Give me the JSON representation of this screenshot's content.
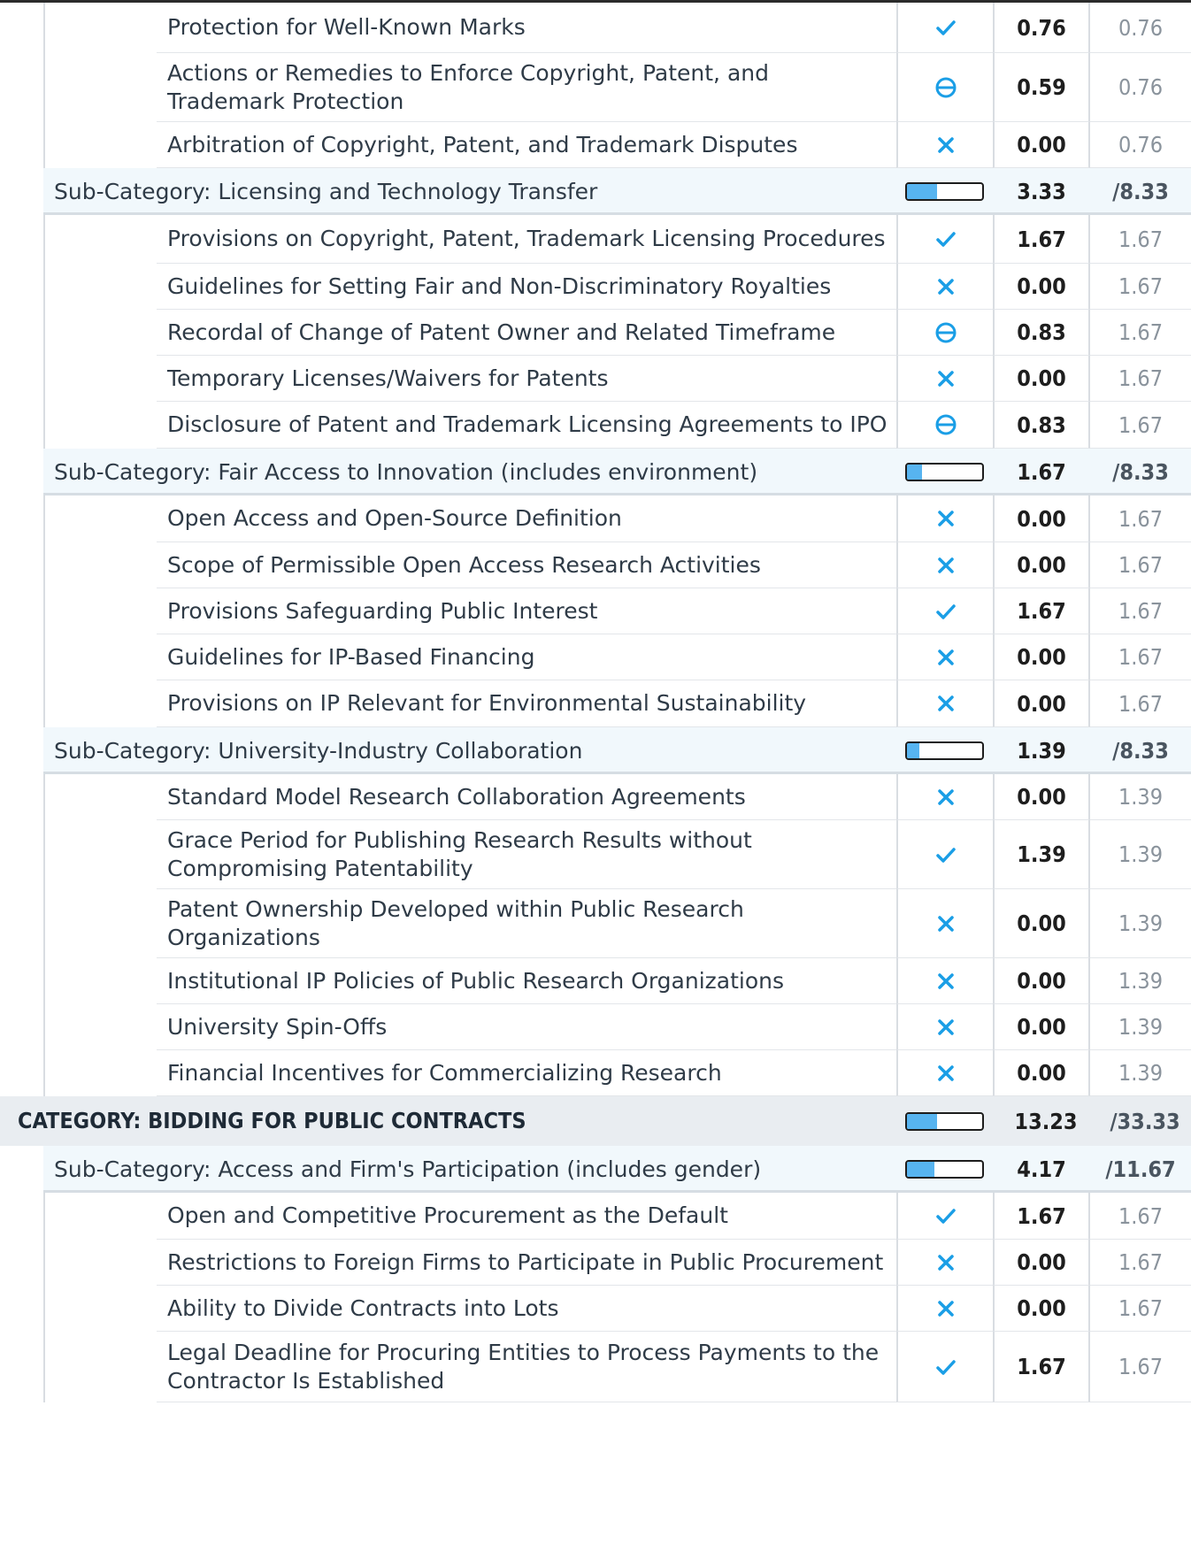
{
  "colors": {
    "accent": "#1a9ee6",
    "bar_fill": "#57b4f0",
    "subcategory_bg": "#f1f8fc",
    "category_bg": "#e9edf1"
  },
  "rows": [
    {
      "kind": "item",
      "label": "Protection for Well-Known Marks",
      "status": "met",
      "score": "0.76",
      "max": "0.76"
    },
    {
      "kind": "item",
      "label": "Actions or Remedies to Enforce Copyright, Patent, and Trademark Protection",
      "status": "partial",
      "score": "0.59",
      "max": "0.76"
    },
    {
      "kind": "item",
      "label": "Arbitration of Copyright, Patent, and Trademark Disputes",
      "status": "not-met",
      "score": "0.00",
      "max": "0.76"
    },
    {
      "kind": "sub",
      "label": "Sub-Category: Licensing and Technology Transfer",
      "progress": 0.4,
      "score": "3.33",
      "max": "/8.33"
    },
    {
      "kind": "item",
      "label": "Provisions on Copyright, Patent, Trademark Licensing Procedures",
      "status": "met",
      "score": "1.67",
      "max": "1.67"
    },
    {
      "kind": "item",
      "label": "Guidelines for Setting Fair and Non-Discriminatory Royalties",
      "status": "not-met",
      "score": "0.00",
      "max": "1.67"
    },
    {
      "kind": "item",
      "label": "Recordal of Change of Patent Owner and Related Timeframe",
      "status": "partial",
      "score": "0.83",
      "max": "1.67"
    },
    {
      "kind": "item",
      "label": "Temporary Licenses/Waivers for Patents",
      "status": "not-met",
      "score": "0.00",
      "max": "1.67"
    },
    {
      "kind": "item",
      "label": "Disclosure of Patent and Trademark Licensing Agreements to IPO",
      "status": "partial",
      "score": "0.83",
      "max": "1.67"
    },
    {
      "kind": "sub",
      "label": "Sub-Category: Fair Access to Innovation (includes environment)",
      "progress": 0.2,
      "score": "1.67",
      "max": "/8.33"
    },
    {
      "kind": "item",
      "label": "Open Access and Open-Source Definition",
      "status": "not-met",
      "score": "0.00",
      "max": "1.67"
    },
    {
      "kind": "item",
      "label": "Scope of Permissible Open Access Research Activities",
      "status": "not-met",
      "score": "0.00",
      "max": "1.67"
    },
    {
      "kind": "item",
      "label": "Provisions Safeguarding Public Interest",
      "status": "met",
      "score": "1.67",
      "max": "1.67"
    },
    {
      "kind": "item",
      "label": "Guidelines for IP-Based Financing",
      "status": "not-met",
      "score": "0.00",
      "max": "1.67"
    },
    {
      "kind": "item",
      "label": "Provisions on IP Relevant for Environmental Sustainability",
      "status": "not-met",
      "score": "0.00",
      "max": "1.67"
    },
    {
      "kind": "sub",
      "label": "Sub-Category: University-Industry Collaboration",
      "progress": 0.167,
      "score": "1.39",
      "max": "/8.33"
    },
    {
      "kind": "item",
      "label": "Standard Model Research Collaboration Agreements",
      "status": "not-met",
      "score": "0.00",
      "max": "1.39"
    },
    {
      "kind": "item",
      "label": "Grace Period for Publishing Research Results without Compromising Patentability",
      "status": "met",
      "score": "1.39",
      "max": "1.39"
    },
    {
      "kind": "item",
      "label": "Patent Ownership Developed within Public Research Organizations",
      "status": "not-met",
      "score": "0.00",
      "max": "1.39"
    },
    {
      "kind": "item",
      "label": "Institutional IP Policies of Public Research Organizations",
      "status": "not-met",
      "score": "0.00",
      "max": "1.39"
    },
    {
      "kind": "item",
      "label": "University Spin-Offs",
      "status": "not-met",
      "score": "0.00",
      "max": "1.39"
    },
    {
      "kind": "item",
      "label": "Financial Incentives for Commercializing Research",
      "status": "not-met",
      "score": "0.00",
      "max": "1.39"
    },
    {
      "kind": "cat",
      "label": "CATEGORY: BIDDING FOR PUBLIC CONTRACTS",
      "progress": 0.397,
      "score": "13.23",
      "max": "/33.33"
    },
    {
      "kind": "sub",
      "label": "Sub-Category: Access and Firm's Participation (includes gender)",
      "progress": 0.357,
      "score": "4.17",
      "max": "/11.67"
    },
    {
      "kind": "item",
      "label": "Open and Competitive Procurement as the Default",
      "status": "met",
      "score": "1.67",
      "max": "1.67"
    },
    {
      "kind": "item",
      "label": "Restrictions to Foreign Firms to Participate in Public Procurement",
      "status": "not-met",
      "score": "0.00",
      "max": "1.67"
    },
    {
      "kind": "item",
      "label": "Ability to Divide Contracts into Lots",
      "status": "not-met",
      "score": "0.00",
      "max": "1.67"
    },
    {
      "kind": "item",
      "label": "Legal Deadline for Procuring Entities to Process Payments to the Contractor Is Established",
      "status": "met",
      "score": "1.67",
      "max": "1.67"
    }
  ]
}
